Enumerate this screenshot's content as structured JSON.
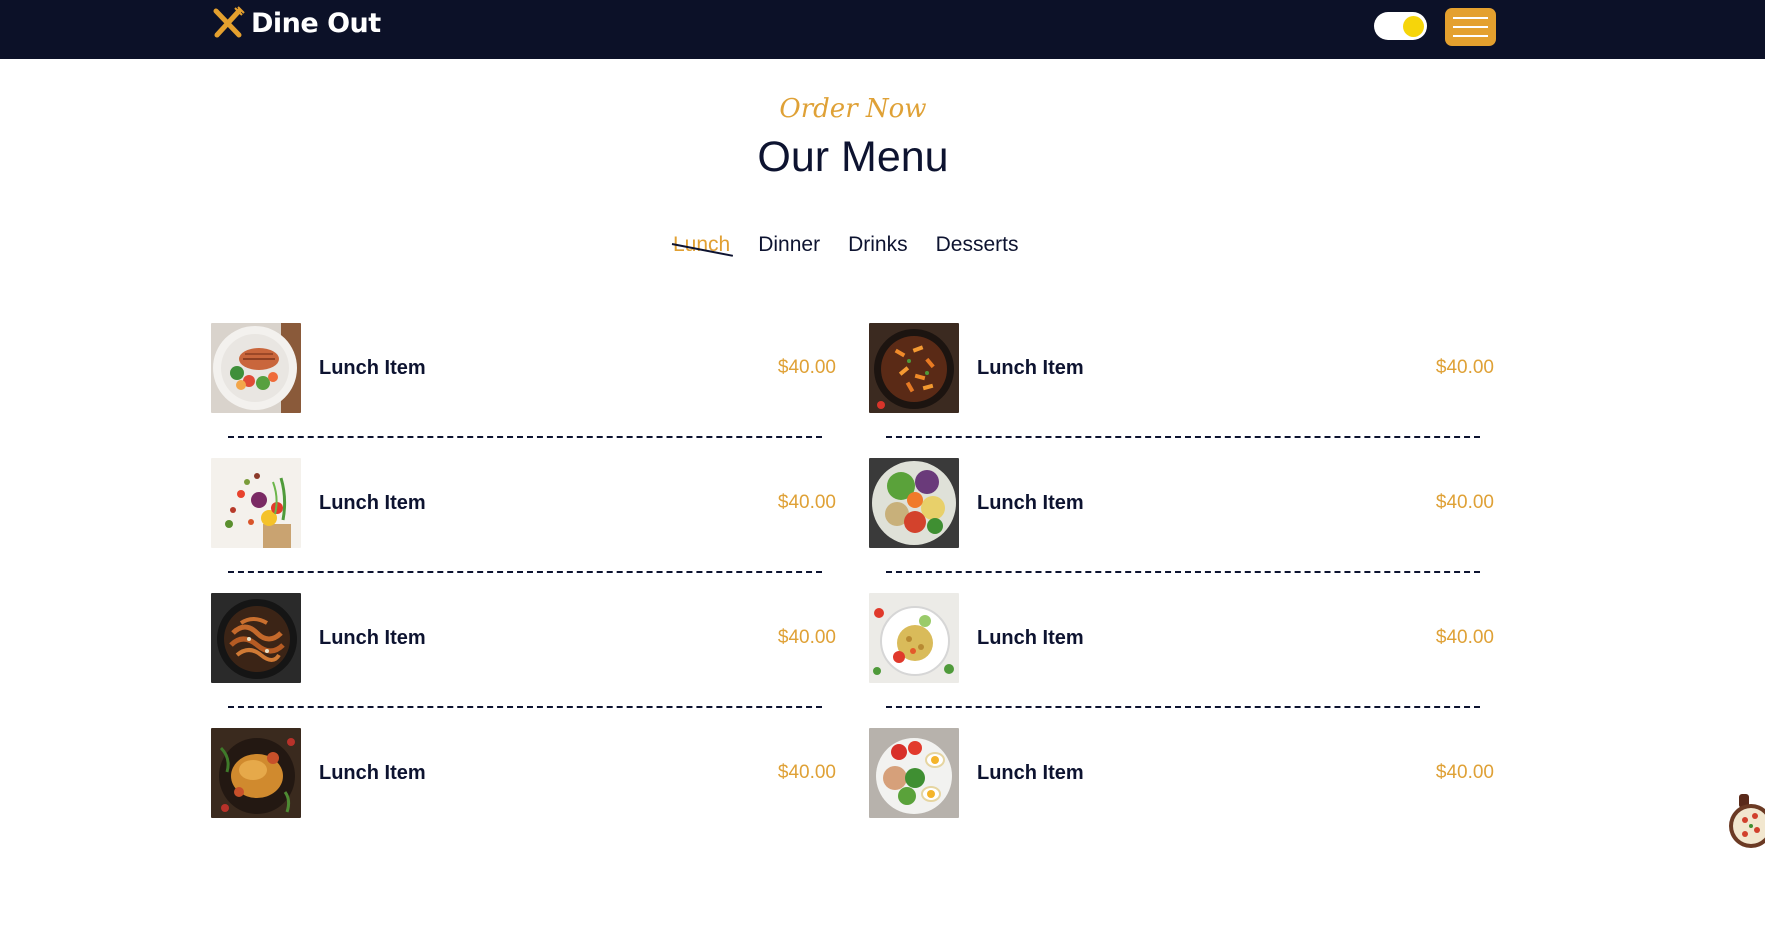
{
  "header": {
    "brand": "Dine Out",
    "menu_button": "menu",
    "theme_toggle": "theme"
  },
  "section": {
    "eyebrow": "Order Now",
    "title": "Our Menu"
  },
  "tabs": [
    {
      "label": "Lunch",
      "active": true
    },
    {
      "label": "Dinner",
      "active": false
    },
    {
      "label": "Drinks",
      "active": false
    },
    {
      "label": "Desserts",
      "active": false
    }
  ],
  "menu": {
    "left": [
      {
        "name": "Lunch Item",
        "price": "$40.00",
        "image": "salmon-plate"
      },
      {
        "name": "Lunch Item",
        "price": "$40.00",
        "image": "vegetable-bag"
      },
      {
        "name": "Lunch Item",
        "price": "$40.00",
        "image": "noodle-bowl"
      },
      {
        "name": "Lunch Item",
        "price": "$40.00",
        "image": "roast-chicken"
      }
    ],
    "right": [
      {
        "name": "Lunch Item",
        "price": "$40.00",
        "image": "pasta-pan"
      },
      {
        "name": "Lunch Item",
        "price": "$40.00",
        "image": "salad-bowl"
      },
      {
        "name": "Lunch Item",
        "price": "$40.00",
        "image": "rice-plate"
      },
      {
        "name": "Lunch Item",
        "price": "$40.00",
        "image": "egg-salad"
      }
    ]
  },
  "colors": {
    "navbar": "#0c1128",
    "accent": "#e4a02e",
    "text": "#0d1330",
    "toggle_knob": "#f6d50a"
  }
}
